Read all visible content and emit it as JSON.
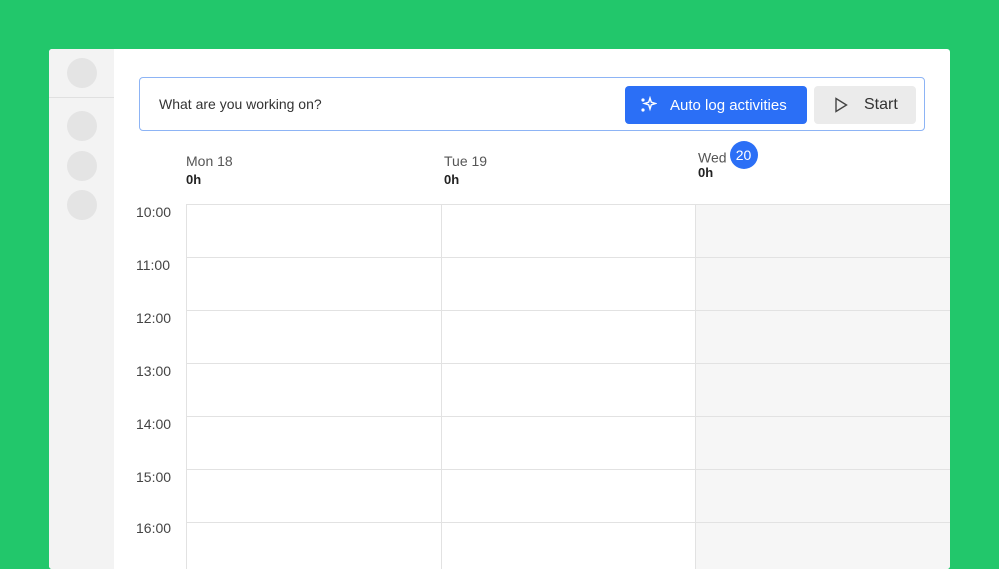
{
  "timer": {
    "placeholder": "What are you working on?",
    "auto_log_label": "Auto log activities",
    "start_label": "Start"
  },
  "days": [
    {
      "label": "Mon 18",
      "total": "0h"
    },
    {
      "label": "Tue 19",
      "total": "0h"
    },
    {
      "label": "Wed",
      "date": "20",
      "total": "0h"
    }
  ],
  "times": [
    "10:00",
    "11:00",
    "12:00",
    "13:00",
    "14:00",
    "15:00",
    "16:00"
  ],
  "colors": {
    "accent": "#2b6ff6",
    "background": "#22c76b"
  }
}
